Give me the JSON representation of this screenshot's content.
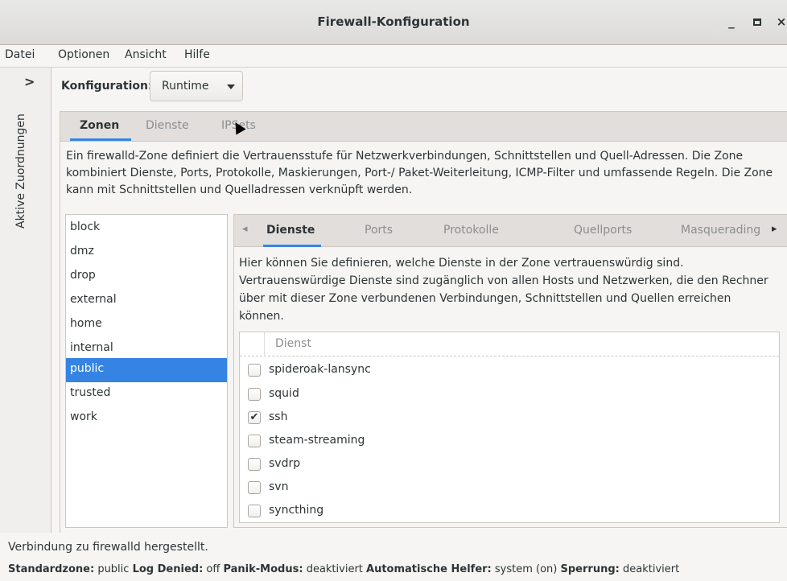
{
  "window": {
    "title": "Firewall-Konfiguration",
    "minimize_label": "_",
    "close_label": "×"
  },
  "menubar": {
    "items": [
      "Datei",
      "Optionen",
      "Ansicht",
      "Hilfe"
    ]
  },
  "sidebar": {
    "expand_glyph": ">",
    "label": "Aktive Zuordnungen"
  },
  "configuration": {
    "label": "Konfiguration:",
    "selected": "Runtime"
  },
  "main_tabs": [
    {
      "label": "Zonen",
      "active": true
    },
    {
      "label": "Dienste",
      "active": false
    },
    {
      "label": "IPSets",
      "active": false
    }
  ],
  "zone_description": "Ein firewalld-Zone definiert die Vertrauensstufe für Netzwerkverbindungen, Schnittstellen und Quell-Adressen. Die Zone kombiniert Dienste, Ports, Protokolle, Maskierungen, Port-/ Paket-Weiterleitung, ICMP-Filter und umfassende Regeln. Die Zone kann mit Schnittstellen und Quelladressen verknüpft werden.",
  "zones": {
    "items": [
      "block",
      "dmz",
      "drop",
      "external",
      "home",
      "internal",
      "public",
      "trusted",
      "work"
    ],
    "selected": "public"
  },
  "sub_tabs": {
    "left_arrow": "◂",
    "right_arrow": "▸",
    "items": [
      {
        "label": "Dienste",
        "active": true
      },
      {
        "label": "Ports",
        "active": false
      },
      {
        "label": "Protokolle",
        "active": false
      },
      {
        "label": "Quellports",
        "active": false
      },
      {
        "label": "Masquerading",
        "active": false
      }
    ]
  },
  "services_description": "Hier können Sie definieren, welche Dienste in der Zone vertrauenswürdig sind. Vertrauenswürdige Dienste sind zugänglich von allen Hosts und Netzwerken, die den Rechner über mit dieser Zone verbundenen Verbindungen, Schnittstellen und Quellen erreichen können.",
  "services_table": {
    "column_header": "Dienst",
    "rows": [
      {
        "name": "spideroak-lansync",
        "checked": false
      },
      {
        "name": "squid",
        "checked": false
      },
      {
        "name": "ssh",
        "checked": true
      },
      {
        "name": "steam-streaming",
        "checked": false
      },
      {
        "name": "svdrp",
        "checked": false
      },
      {
        "name": "svn",
        "checked": false
      },
      {
        "name": "syncthing",
        "checked": false
      }
    ]
  },
  "status": {
    "connection": "Verbindung zu firewalld hergestellt.",
    "standardzone_label": "Standardzone:",
    "standardzone_value": "public",
    "log_denied_label": "Log Denied:",
    "log_denied_value": "off",
    "panik_label": "Panik-Modus:",
    "panik_value": "deaktiviert",
    "helper_label": "Automatische Helfer:",
    "helper_value": "system (on)",
    "lock_label": "Sperrung:",
    "lock_value": "deaktiviert"
  },
  "colors": {
    "accent": "#3584e4",
    "background": "#f6f5f4",
    "tab_bar": "#e1dedb",
    "text": "#2e3436",
    "inactive_text": "#8b8e8f"
  }
}
